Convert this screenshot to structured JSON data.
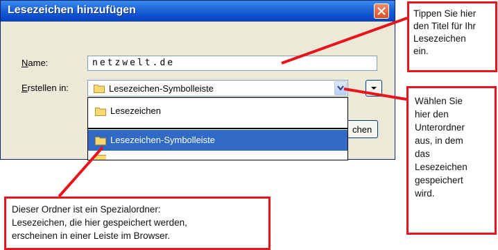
{
  "dialog": {
    "title": "Lesezeichen hinzufügen",
    "name_label": "Name:",
    "name_value": "netzwelt.de",
    "folder_label": "Erstellen in:",
    "folder_selected": "Lesezeichen-Symbolleiste",
    "dropdown_items": [
      {
        "label": "Lesezeichen",
        "selected": false
      },
      {
        "label": "Lesezeichen-Symbolleiste",
        "selected": true
      }
    ],
    "partial_button_label": "chen"
  },
  "callouts": {
    "title_hint": [
      "Tippen Sie hier",
      "den Titel für Ihr",
      "Lesezeichen",
      "ein."
    ],
    "folder_hint": [
      "Wählen Sie",
      "hier den",
      "Unterordner",
      "aus, in dem",
      "das",
      "Lesezeichen",
      "gespeichert",
      "wird."
    ],
    "special_folder_hint": [
      "Dieser Ordner ist ein Spezialordner:",
      "Lesezeichen, die hier gespeichert werden,",
      "erscheinen in einer Leiste im Browser."
    ]
  },
  "colors": {
    "titlebar": "#0a4fd0",
    "selection": "#316ac5",
    "callout_border": "#e8141c",
    "dialog_bg": "#ece9d8"
  },
  "icons": [
    "close-icon",
    "chevron-down-icon",
    "folder-icon"
  ]
}
